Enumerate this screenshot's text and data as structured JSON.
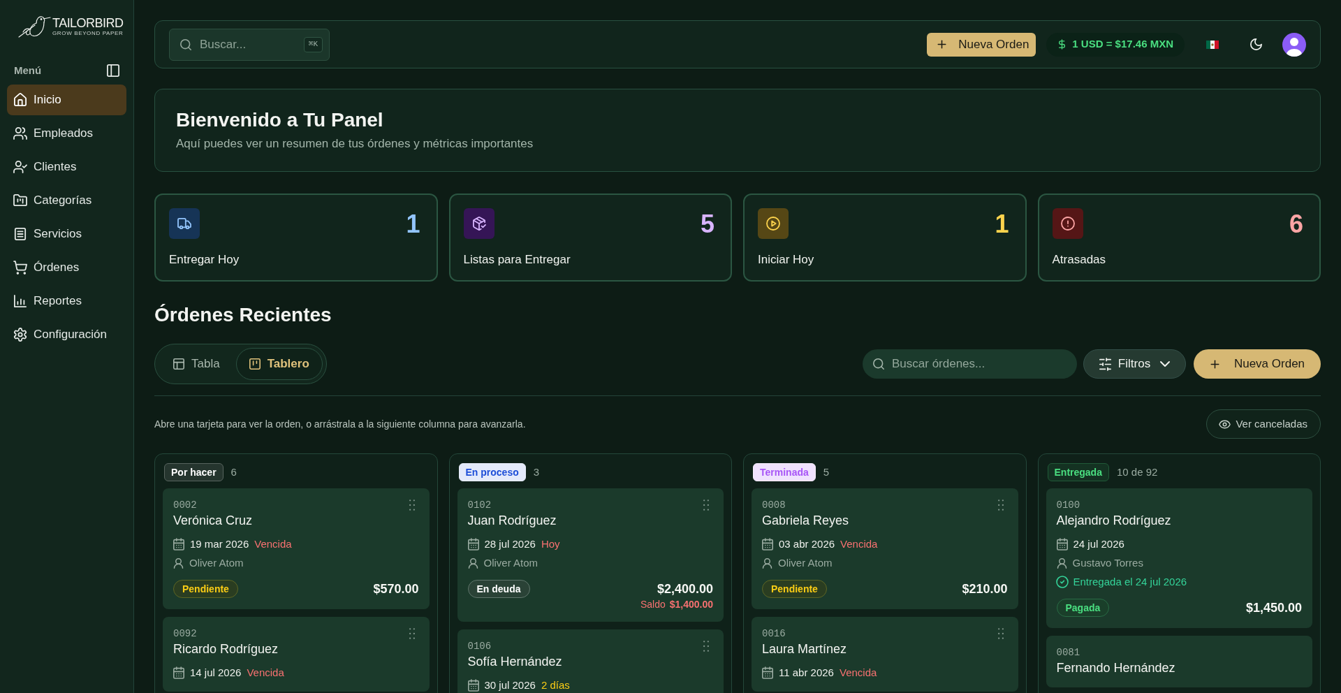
{
  "sidebar": {
    "logo": {
      "name": "TAILORBIRD",
      "tagline": "GROW BEYOND PAPER"
    },
    "menu_label": "Menú",
    "items": [
      {
        "label": "Inicio",
        "selected": true
      },
      {
        "label": "Empleados",
        "selected": false
      },
      {
        "label": "Clientes",
        "selected": false
      },
      {
        "label": "Categorías",
        "selected": false
      },
      {
        "label": "Servicios",
        "selected": false
      },
      {
        "label": "Órdenes",
        "selected": false
      },
      {
        "label": "Reportes",
        "selected": false
      },
      {
        "label": "Configuración",
        "selected": false
      }
    ]
  },
  "header": {
    "search": {
      "placeholder": "Buscar...",
      "shortcut": "⌘K"
    },
    "new_order_button": "Nueva Orden",
    "exchange_rate": "1 USD = $17.46 MXN"
  },
  "welcome": {
    "title": "Bienvenido a Tu Panel",
    "subtitle": "Aquí puedes ver un resumen de tus órdenes y métricas importantes"
  },
  "stats": [
    {
      "label": "Entregar Hoy",
      "value": "1",
      "color": "#93c5fd"
    },
    {
      "label": "Listas para Entregar",
      "value": "5",
      "color": "#d8b4fe"
    },
    {
      "label": "Iniciar Hoy",
      "value": "1",
      "color": "#fcd34d"
    },
    {
      "label": "Atrasadas",
      "value": "6",
      "color": "#fca5a5"
    }
  ],
  "recent_orders": {
    "title": "Órdenes Recientes",
    "view_tabs": [
      {
        "label": "Tabla",
        "selected": false
      },
      {
        "label": "Tablero",
        "selected": true
      }
    ],
    "search": {
      "placeholder": "Buscar órdenes..."
    },
    "filters_button": "Filtros",
    "new_order_button": "Nueva Orden",
    "hint": "Abre una tarjeta para ver la orden, o arrástrala a la siguiente columna para avanzarla.",
    "show_cancelled_button": "Ver canceladas",
    "columns": [
      {
        "tag": {
          "label": "Por hacer",
          "kind": "outline",
          "color": "#ffffff"
        },
        "count": "6",
        "cards": [
          {
            "id": "0002",
            "customer": "Verónica Cruz",
            "draggable": true,
            "date": "19 mar 2026",
            "due": {
              "text": "Vencida",
              "color": "#f87171"
            },
            "assignee": "Oliver Atom",
            "payment": {
              "label": "Pendiente",
              "color": "#facc15"
            },
            "total": "$570.00"
          },
          {
            "id": "0092",
            "customer": "Ricardo Rodríguez",
            "draggable": true,
            "date": "14 jul 2026",
            "due": {
              "text": "Vencida",
              "color": "#f87171"
            }
          }
        ]
      },
      {
        "tag": {
          "label": "En proceso",
          "kind": "solid",
          "color": "#1d4ed8"
        },
        "count": "3",
        "cards": [
          {
            "id": "0102",
            "customer": "Juan Rodríguez",
            "draggable": true,
            "date": "28 jul 2026",
            "due": {
              "text": "Hoy",
              "color": "#f87171"
            },
            "assignee": "Oliver Atom",
            "payment": {
              "label": "En deuda",
              "color": "#ffffff"
            },
            "total": "$2,400.00",
            "balance": {
              "label": "Saldo",
              "amount": "$1,400.00"
            }
          },
          {
            "id": "0106",
            "customer": "Sofía Hernández",
            "draggable": true,
            "date": "30 jul 2026",
            "due": {
              "text": "2 días",
              "color": "#facc15"
            }
          }
        ]
      },
      {
        "tag": {
          "label": "Terminada",
          "kind": "solid",
          "color": "#a855f7"
        },
        "count": "5",
        "cards": [
          {
            "id": "0008",
            "customer": "Gabriela Reyes",
            "draggable": true,
            "date": "03 abr 2026",
            "due": {
              "text": "Vencida",
              "color": "#f87171"
            },
            "assignee": "Oliver Atom",
            "payment": {
              "label": "Pendiente",
              "color": "#facc15"
            },
            "total": "$210.00"
          },
          {
            "id": "0016",
            "customer": "Laura Martínez",
            "draggable": true,
            "date": "11 abr 2026",
            "due": {
              "text": "Vencida",
              "color": "#f87171"
            }
          }
        ]
      },
      {
        "tag": {
          "label": "Entregada",
          "kind": "outline",
          "color": "#4ade80"
        },
        "count": "10 de 92",
        "cards": [
          {
            "id": "0100",
            "customer": "Alejandro Rodríguez",
            "draggable": false,
            "date": "24 jul 2026",
            "assignee": "Gustavo Torres",
            "delivered": "Entregada el 24 jul 2026",
            "payment": {
              "label": "Pagada",
              "color": "#4ade80"
            },
            "total": "$1,450.00"
          },
          {
            "id": "0081",
            "customer": "Fernando Hernández",
            "draggable": false
          }
        ]
      }
    ]
  }
}
